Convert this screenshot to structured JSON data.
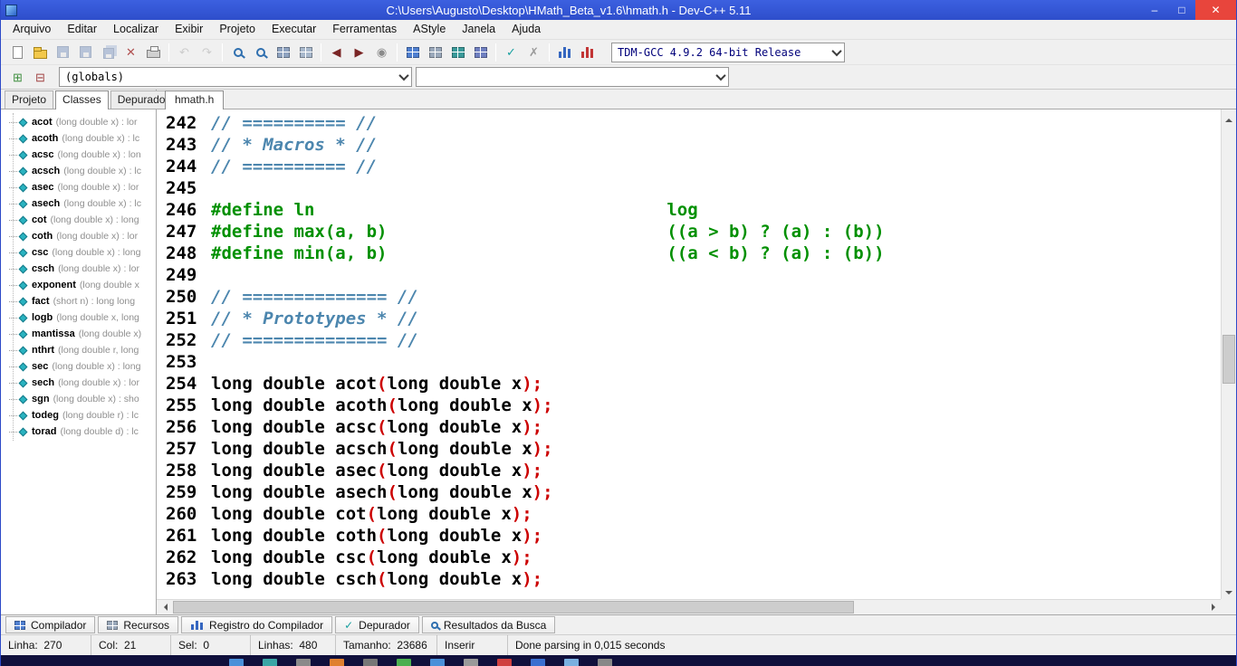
{
  "window": {
    "title": "C:\\Users\\Augusto\\Desktop\\HMath_Beta_v1.6\\hmath.h - Dev-C++ 5.11",
    "controls": [
      {
        "name": "minimize-button",
        "glyph": "–"
      },
      {
        "name": "maximize-button",
        "glyph": "□"
      },
      {
        "name": "close-button",
        "glyph": "✕"
      }
    ]
  },
  "menu": {
    "items": [
      "Arquivo",
      "Editar",
      "Localizar",
      "Exibir",
      "Projeto",
      "Executar",
      "Ferramentas",
      "AStyle",
      "Janela",
      "Ajuda"
    ]
  },
  "toolbar": {
    "compiler_value": "TDM-GCC 4.9.2 64-bit Release",
    "main": [
      {
        "name": "new-file",
        "kind": "cls",
        "v": "i-page"
      },
      {
        "name": "open-file",
        "kind": "cls",
        "v": "i-folder"
      },
      {
        "name": "save",
        "kind": "cls",
        "v": "i-floppy",
        "off": true
      },
      {
        "name": "save-as",
        "kind": "cls",
        "v": "i-floppy",
        "off": true
      },
      {
        "name": "save-all",
        "kind": "cls",
        "v": "i-floppy2",
        "off": true
      },
      {
        "name": "close-file",
        "kind": "glyph",
        "v": "✕",
        "color": "#b05050"
      },
      {
        "name": "print",
        "kind": "cls",
        "v": "i-print"
      },
      {
        "kind": "sep"
      },
      {
        "name": "undo",
        "kind": "glyph",
        "v": "↶",
        "color": "#9a9a9a",
        "off": true
      },
      {
        "name": "redo",
        "kind": "glyph",
        "v": "↷",
        "color": "#9a9a9a",
        "off": true
      },
      {
        "kind": "sep"
      },
      {
        "name": "find",
        "kind": "cls",
        "v": "i-mag"
      },
      {
        "name": "replace",
        "kind": "cls",
        "v": "i-mag"
      },
      {
        "name": "goto-line",
        "kind": "cls",
        "v": "i-win",
        "color": "#8fa3c0"
      },
      {
        "name": "insert",
        "kind": "cls",
        "v": "i-win",
        "color": "#a8b8cc"
      },
      {
        "kind": "sep"
      },
      {
        "name": "back",
        "kind": "glyph",
        "v": "◀",
        "color": "#7a2525"
      },
      {
        "name": "forward",
        "kind": "glyph",
        "v": "▶",
        "color": "#7a2525"
      },
      {
        "name": "abort",
        "kind": "glyph",
        "v": "◉",
        "color": "#8a8a8a"
      },
      {
        "kind": "sep"
      },
      {
        "name": "compile",
        "kind": "cls",
        "v": "i-win",
        "color": "#4f7fd0"
      },
      {
        "name": "run",
        "kind": "cls",
        "v": "i-win",
        "color": "#9aa8ba"
      },
      {
        "name": "compile-run",
        "kind": "cls",
        "v": "i-win",
        "color": "#3a9a9a"
      },
      {
        "name": "rebuild-all",
        "kind": "cls",
        "v": "i-win",
        "color": "#6f7fc0"
      },
      {
        "kind": "sep"
      },
      {
        "name": "debug",
        "kind": "glyph",
        "v": "✓",
        "color": "#18a0a0"
      },
      {
        "name": "stop-execution",
        "kind": "glyph",
        "v": "✗",
        "color": "#9a9a9a"
      },
      {
        "kind": "sep"
      },
      {
        "name": "profile-analysis",
        "kind": "cls",
        "v": "i-bars",
        "color": "#3566c0"
      },
      {
        "name": "delete-profiling",
        "kind": "cls",
        "v": "i-bars",
        "color": "#c23535"
      }
    ]
  },
  "navbar": {
    "icons": [
      {
        "name": "add-to-project",
        "kind": "glyph",
        "v": "⊞",
        "color": "#3f8f3f"
      },
      {
        "name": "remove-from-project",
        "kind": "glyph",
        "v": "⊟",
        "color": "#a04040"
      }
    ],
    "globals_value": "(globals)",
    "members_value": ""
  },
  "left_panel": {
    "tabs": [
      "Projeto",
      "Classes",
      "Depurador"
    ],
    "active": "Classes"
  },
  "class_tree": [
    {
      "name": "acot",
      "sig": "(long double x) : lor"
    },
    {
      "name": "acoth",
      "sig": "(long double x) : lc"
    },
    {
      "name": "acsc",
      "sig": "(long double x) : lon"
    },
    {
      "name": "acsch",
      "sig": "(long double x) : lc"
    },
    {
      "name": "asec",
      "sig": "(long double x) : lor"
    },
    {
      "name": "asech",
      "sig": "(long double x) : lc"
    },
    {
      "name": "cot",
      "sig": "(long double x) : long"
    },
    {
      "name": "coth",
      "sig": "(long double x) : lor"
    },
    {
      "name": "csc",
      "sig": "(long double x) : long"
    },
    {
      "name": "csch",
      "sig": "(long double x) : lor"
    },
    {
      "name": "exponent",
      "sig": "(long double x"
    },
    {
      "name": "fact",
      "sig": "(short n) : long long"
    },
    {
      "name": "logb",
      "sig": "(long double x, long"
    },
    {
      "name": "mantissa",
      "sig": "(long double x)"
    },
    {
      "name": "nthrt",
      "sig": "(long double r, long"
    },
    {
      "name": "sec",
      "sig": "(long double x) : long"
    },
    {
      "name": "sech",
      "sig": "(long double x) : lor"
    },
    {
      "name": "sgn",
      "sig": "(long double x) : sho"
    },
    {
      "name": "todeg",
      "sig": "(long double r) : lc"
    },
    {
      "name": "torad",
      "sig": "(long double d) : lc"
    }
  ],
  "editor": {
    "tab_label": "hmath.h",
    "lines": [
      {
        "n": "242",
        "seg": [
          {
            "t": "c",
            "s": "// ========== //"
          }
        ]
      },
      {
        "n": "243",
        "seg": [
          {
            "t": "c",
            "s": "// * Macros * //"
          }
        ]
      },
      {
        "n": "244",
        "seg": [
          {
            "t": "c",
            "s": "// ========== //"
          }
        ]
      },
      {
        "n": "245",
        "seg": []
      },
      {
        "n": "246",
        "seg": [
          {
            "t": "p",
            "s": "#define ln                                  log"
          }
        ]
      },
      {
        "n": "247",
        "seg": [
          {
            "t": "p",
            "s": "#define max(a, b)                           ((a > b) ? (a) : (b))"
          }
        ]
      },
      {
        "n": "248",
        "seg": [
          {
            "t": "p",
            "s": "#define min(a, b)                           ((a < b) ? (a) : (b))"
          }
        ]
      },
      {
        "n": "249",
        "seg": []
      },
      {
        "n": "250",
        "seg": [
          {
            "t": "c",
            "s": "// ============== //"
          }
        ]
      },
      {
        "n": "251",
        "seg": [
          {
            "t": "c",
            "s": "// * Prototypes * //"
          }
        ]
      },
      {
        "n": "252",
        "seg": [
          {
            "t": "c",
            "s": "// ============== //"
          }
        ]
      },
      {
        "n": "253",
        "seg": []
      },
      {
        "n": "254",
        "seg": [
          {
            "t": "k",
            "s": "long double"
          },
          {
            "t": "i",
            "s": " acot"
          },
          {
            "t": "s",
            "s": "("
          },
          {
            "t": "k",
            "s": "long double"
          },
          {
            "t": "i",
            "s": " x"
          },
          {
            "t": "s",
            "s": ");"
          }
        ]
      },
      {
        "n": "255",
        "seg": [
          {
            "t": "k",
            "s": "long double"
          },
          {
            "t": "i",
            "s": " acoth"
          },
          {
            "t": "s",
            "s": "("
          },
          {
            "t": "k",
            "s": "long double"
          },
          {
            "t": "i",
            "s": " x"
          },
          {
            "t": "s",
            "s": ");"
          }
        ]
      },
      {
        "n": "256",
        "seg": [
          {
            "t": "k",
            "s": "long double"
          },
          {
            "t": "i",
            "s": " acsc"
          },
          {
            "t": "s",
            "s": "("
          },
          {
            "t": "k",
            "s": "long double"
          },
          {
            "t": "i",
            "s": " x"
          },
          {
            "t": "s",
            "s": ");"
          }
        ]
      },
      {
        "n": "257",
        "seg": [
          {
            "t": "k",
            "s": "long double"
          },
          {
            "t": "i",
            "s": " acsch"
          },
          {
            "t": "s",
            "s": "("
          },
          {
            "t": "k",
            "s": "long double"
          },
          {
            "t": "i",
            "s": " x"
          },
          {
            "t": "s",
            "s": ");"
          }
        ]
      },
      {
        "n": "258",
        "seg": [
          {
            "t": "k",
            "s": "long double"
          },
          {
            "t": "i",
            "s": " asec"
          },
          {
            "t": "s",
            "s": "("
          },
          {
            "t": "k",
            "s": "long double"
          },
          {
            "t": "i",
            "s": " x"
          },
          {
            "t": "s",
            "s": ");"
          }
        ]
      },
      {
        "n": "259",
        "seg": [
          {
            "t": "k",
            "s": "long double"
          },
          {
            "t": "i",
            "s": " asech"
          },
          {
            "t": "s",
            "s": "("
          },
          {
            "t": "k",
            "s": "long double"
          },
          {
            "t": "i",
            "s": " x"
          },
          {
            "t": "s",
            "s": ");"
          }
        ]
      },
      {
        "n": "260",
        "seg": [
          {
            "t": "k",
            "s": "long double"
          },
          {
            "t": "i",
            "s": " cot"
          },
          {
            "t": "s",
            "s": "("
          },
          {
            "t": "k",
            "s": "long double"
          },
          {
            "t": "i",
            "s": " x"
          },
          {
            "t": "s",
            "s": ");"
          }
        ]
      },
      {
        "n": "261",
        "seg": [
          {
            "t": "k",
            "s": "long double"
          },
          {
            "t": "i",
            "s": " coth"
          },
          {
            "t": "s",
            "s": "("
          },
          {
            "t": "k",
            "s": "long double"
          },
          {
            "t": "i",
            "s": " x"
          },
          {
            "t": "s",
            "s": ");"
          }
        ]
      },
      {
        "n": "262",
        "seg": [
          {
            "t": "k",
            "s": "long double"
          },
          {
            "t": "i",
            "s": " csc"
          },
          {
            "t": "s",
            "s": "("
          },
          {
            "t": "k",
            "s": "long double"
          },
          {
            "t": "i",
            "s": " x"
          },
          {
            "t": "s",
            "s": ");"
          }
        ]
      },
      {
        "n": "263",
        "seg": [
          {
            "t": "k",
            "s": "long double"
          },
          {
            "t": "i",
            "s": " csch"
          },
          {
            "t": "s",
            "s": "("
          },
          {
            "t": "k",
            "s": "long double"
          },
          {
            "t": "i",
            "s": " x"
          },
          {
            "t": "s",
            "s": ");"
          }
        ]
      }
    ]
  },
  "bottom_tabs": [
    {
      "label": "Compilador",
      "kind": "cls",
      "v": "i-win",
      "color": "#4f7fd0"
    },
    {
      "label": "Recursos",
      "kind": "cls",
      "v": "i-win",
      "color": "#9aa8ba"
    },
    {
      "label": "Registro do Compilador",
      "kind": "cls",
      "v": "i-bars",
      "color": "#3566c0"
    },
    {
      "label": "Depurador",
      "kind": "glyph",
      "v": "✓",
      "color": "#18a0a0"
    },
    {
      "label": "Resultados da Busca",
      "kind": "cls",
      "v": "i-mag"
    }
  ],
  "status": {
    "segments": [
      "Linha:  270",
      "Col:  21",
      "Sel:  0",
      "Linhas:  480",
      "Tamanho:  23686",
      "Inserir",
      "Done parsing in 0,015 seconds"
    ],
    "widths": [
      100,
      88,
      88,
      94,
      112,
      78,
      0
    ]
  },
  "taskbar": {
    "colors": [
      "#4a90d9",
      "#3aa6a6",
      "#8a8a8a",
      "#e08030",
      "#777777",
      "#4caf50",
      "#4a90d9",
      "#9a9a9a",
      "#d04040",
      "#3a6fd0",
      "#7ab0e0",
      "#888888"
    ]
  },
  "colors": {
    "titlebar": "#3353cf",
    "close_button": "#e8453c",
    "preprocessor": "#009000",
    "comment": "#4c86ae",
    "symbol": "#cc0000",
    "tree_icon": "#2ab3c0"
  }
}
